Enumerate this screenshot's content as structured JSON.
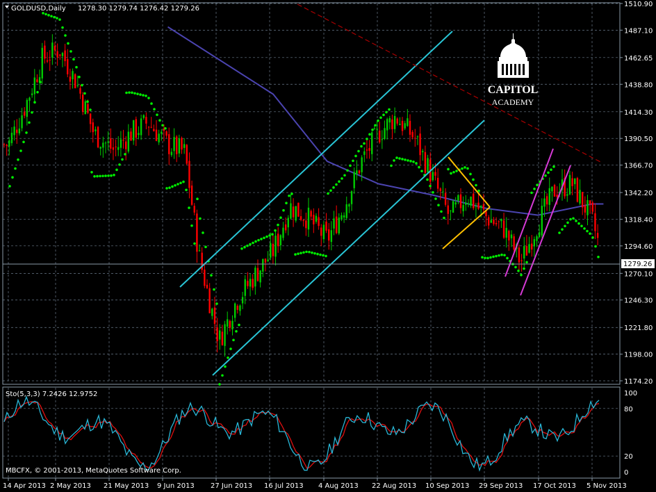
{
  "header": {
    "symbol": "GOLDUSD,Daily",
    "ohlc": "1278.30 1279.74 1276.42 1279.26"
  },
  "price_axis": {
    "ticks": [
      "1510.90",
      "1487.10",
      "1462.65",
      "1438.80",
      "1414.30",
      "1390.50",
      "1366.70",
      "1342.20",
      "1318.40",
      "1294.60",
      "1270.10",
      "1246.30",
      "1221.80",
      "1198.00",
      "1174.20"
    ],
    "current_price_label": "1279.26"
  },
  "indicator": {
    "label": "Sto(5,3,3) 7.2426 12.9752",
    "levels": [
      "100",
      "80",
      "20",
      "0"
    ],
    "copyright": "MBCFX, © 2001-2013, MetaQuotes Software Corp."
  },
  "date_axis": {
    "labels": [
      "14 Apr 2013",
      "2 May 2013",
      "21 May 2013",
      "9 Jun 2013",
      "27 Jun 2013",
      "16 Jul 2013",
      "4 Aug 2013",
      "22 Aug 2013",
      "10 Sep 2013",
      "29 Sep 2013",
      "17 Oct 2013",
      "5 Nov 2013"
    ]
  },
  "logo": {
    "line1": "CAPITOL",
    "line2": "ACADEMY"
  },
  "colors": {
    "background": "#000000",
    "grid": "#6b7b8c",
    "bull_candle": "#00cc00",
    "bear_candle": "#ff0000",
    "sar_dots": "#00ee00",
    "moving_average": "#4b44b0",
    "channel": "#29c5d6",
    "triangle": "#ffc000",
    "wedge": "#d63ad6",
    "resistance": "#aa0000",
    "stoch_main": "#29b6d6",
    "stoch_signal": "#e01010"
  },
  "chart_data": [
    {
      "type": "candlestick",
      "symbol": "GOLDUSD",
      "timeframe": "Daily",
      "ylim": [
        1174.2,
        1510.9
      ],
      "x_labels": [
        "14 Apr 2013",
        "2 May 2013",
        "21 May 2013",
        "9 Jun 2013",
        "27 Jun 2013",
        "16 Jul 2013",
        "4 Aug 2013",
        "22 Aug 2013",
        "10 Sep 2013",
        "29 Sep 2013",
        "17 Oct 2013",
        "5 Nov 2013"
      ],
      "close_path": [
        [
          "14 Apr 2013",
          1385
        ],
        [
          "20 Apr 2013",
          1420
        ],
        [
          "26 Apr 2013",
          1462
        ],
        [
          "2 May 2013",
          1470
        ],
        [
          "8 May 2013",
          1440
        ],
        [
          "14 May 2013",
          1395
        ],
        [
          "21 May 2013",
          1380
        ],
        [
          "27 May 2013",
          1395
        ],
        [
          "2 Jun 2013",
          1405
        ],
        [
          "9 Jun 2013",
          1385
        ],
        [
          "15 Jun 2013",
          1378
        ],
        [
          "20 Jun 2013",
          1285
        ],
        [
          "27 Jun 2013",
          1210
        ],
        [
          "3 Jul 2013",
          1245
        ],
        [
          "10 Jul 2013",
          1270
        ],
        [
          "16 Jul 2013",
          1290
        ],
        [
          "22 Jul 2013",
          1330
        ],
        [
          "28 Jul 2013",
          1320
        ],
        [
          "4 Aug 2013",
          1300
        ],
        [
          "10 Aug 2013",
          1330
        ],
        [
          "16 Aug 2013",
          1370
        ],
        [
          "22 Aug 2013",
          1395
        ],
        [
          "28 Aug 2013",
          1410
        ],
        [
          "4 Sep 2013",
          1390
        ],
        [
          "10 Sep 2013",
          1355
        ],
        [
          "16 Sep 2013",
          1320
        ],
        [
          "22 Sep 2013",
          1340
        ],
        [
          "29 Sep 2013",
          1320
        ],
        [
          "5 Oct 2013",
          1310
        ],
        [
          "11 Oct 2013",
          1280
        ],
        [
          "17 Oct 2013",
          1315
        ],
        [
          "23 Oct 2013",
          1345
        ],
        [
          "29 Oct 2013",
          1350
        ],
        [
          "5 Nov 2013",
          1318
        ],
        [
          "9 Nov 2013",
          1279.26
        ]
      ],
      "moving_average_path": [
        [
          "9 Jun 2013",
          1490
        ],
        [
          "16 Jul 2013",
          1430
        ],
        [
          "4 Aug 2013",
          1370
        ],
        [
          "22 Aug 2013",
          1350
        ],
        [
          "10 Sep 2013",
          1340
        ],
        [
          "29 Sep 2013",
          1328
        ],
        [
          "17 Oct 2013",
          1322
        ],
        [
          "5 Nov 2013",
          1332
        ],
        [
          "9 Nov 2013",
          1332
        ]
      ],
      "current_price": 1279.26
    },
    {
      "type": "line",
      "title": "Sto(5,3,3)",
      "values_printed": [
        7.2426,
        12.9752
      ],
      "ylim": [
        0,
        100
      ],
      "levels": [
        20,
        80
      ]
    }
  ]
}
